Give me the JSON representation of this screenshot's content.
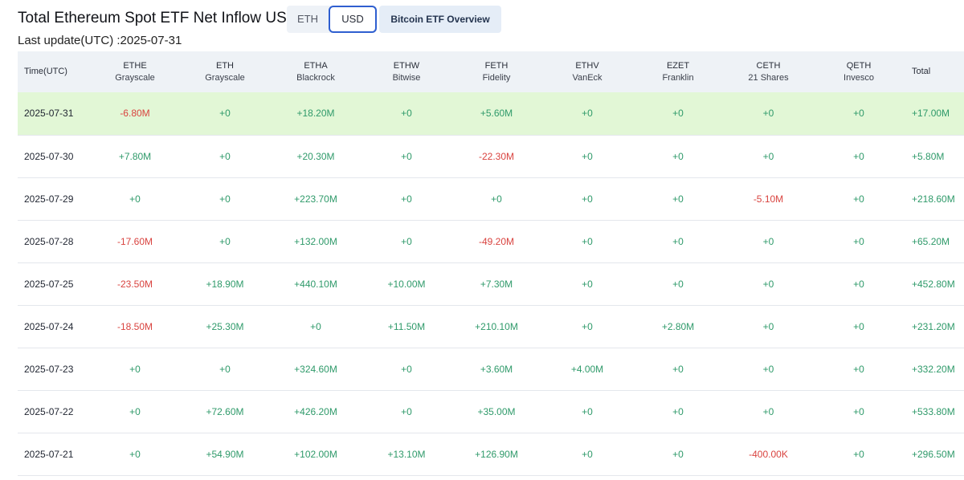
{
  "header": {
    "title": "Total Ethereum Spot ETF Net Inflow USD",
    "last_update": "Last update(UTC) :2025-07-31",
    "toggles": [
      {
        "label": "ETH",
        "active": false
      },
      {
        "label": "USD",
        "active": true
      }
    ],
    "overview_button": "Bitcoin ETF Overview"
  },
  "colors": {
    "positive": "#2f9a6a",
    "negative": "#d9433f",
    "highlight_row": "#e2f7d6",
    "active_border": "#2f5fd0"
  },
  "table": {
    "columns": [
      {
        "ticker": "Time(UTC)",
        "issuer": ""
      },
      {
        "ticker": "ETHE",
        "issuer": "Grayscale"
      },
      {
        "ticker": "ETH",
        "issuer": "Grayscale"
      },
      {
        "ticker": "ETHA",
        "issuer": "Blackrock"
      },
      {
        "ticker": "ETHW",
        "issuer": "Bitwise"
      },
      {
        "ticker": "FETH",
        "issuer": "Fidelity"
      },
      {
        "ticker": "ETHV",
        "issuer": "VanEck"
      },
      {
        "ticker": "EZET",
        "issuer": "Franklin"
      },
      {
        "ticker": "CETH",
        "issuer": "21 Shares"
      },
      {
        "ticker": "QETH",
        "issuer": "Invesco"
      },
      {
        "ticker": "Total",
        "issuer": ""
      }
    ],
    "rows": [
      {
        "date": "2025-07-31",
        "highlight": true,
        "cells": [
          "-6.80M",
          "+0",
          "+18.20M",
          "+0",
          "+5.60M",
          "+0",
          "+0",
          "+0",
          "+0",
          "+17.00M"
        ]
      },
      {
        "date": "2025-07-30",
        "highlight": false,
        "cells": [
          "+7.80M",
          "+0",
          "+20.30M",
          "+0",
          "-22.30M",
          "+0",
          "+0",
          "+0",
          "+0",
          "+5.80M"
        ]
      },
      {
        "date": "2025-07-29",
        "highlight": false,
        "cells": [
          "+0",
          "+0",
          "+223.70M",
          "+0",
          "+0",
          "+0",
          "+0",
          "-5.10M",
          "+0",
          "+218.60M"
        ]
      },
      {
        "date": "2025-07-28",
        "highlight": false,
        "cells": [
          "-17.60M",
          "+0",
          "+132.00M",
          "+0",
          "-49.20M",
          "+0",
          "+0",
          "+0",
          "+0",
          "+65.20M"
        ]
      },
      {
        "date": "2025-07-25",
        "highlight": false,
        "cells": [
          "-23.50M",
          "+18.90M",
          "+440.10M",
          "+10.00M",
          "+7.30M",
          "+0",
          "+0",
          "+0",
          "+0",
          "+452.80M"
        ]
      },
      {
        "date": "2025-07-24",
        "highlight": false,
        "cells": [
          "-18.50M",
          "+25.30M",
          "+0",
          "+11.50M",
          "+210.10M",
          "+0",
          "+2.80M",
          "+0",
          "+0",
          "+231.20M"
        ]
      },
      {
        "date": "2025-07-23",
        "highlight": false,
        "cells": [
          "+0",
          "+0",
          "+324.60M",
          "+0",
          "+3.60M",
          "+4.00M",
          "+0",
          "+0",
          "+0",
          "+332.20M"
        ]
      },
      {
        "date": "2025-07-22",
        "highlight": false,
        "cells": [
          "+0",
          "+72.60M",
          "+426.20M",
          "+0",
          "+35.00M",
          "+0",
          "+0",
          "+0",
          "+0",
          "+533.80M"
        ]
      },
      {
        "date": "2025-07-21",
        "highlight": false,
        "cells": [
          "+0",
          "+54.90M",
          "+102.00M",
          "+13.10M",
          "+126.90M",
          "+0",
          "+0",
          "-400.00K",
          "+0",
          "+296.50M"
        ]
      }
    ]
  }
}
